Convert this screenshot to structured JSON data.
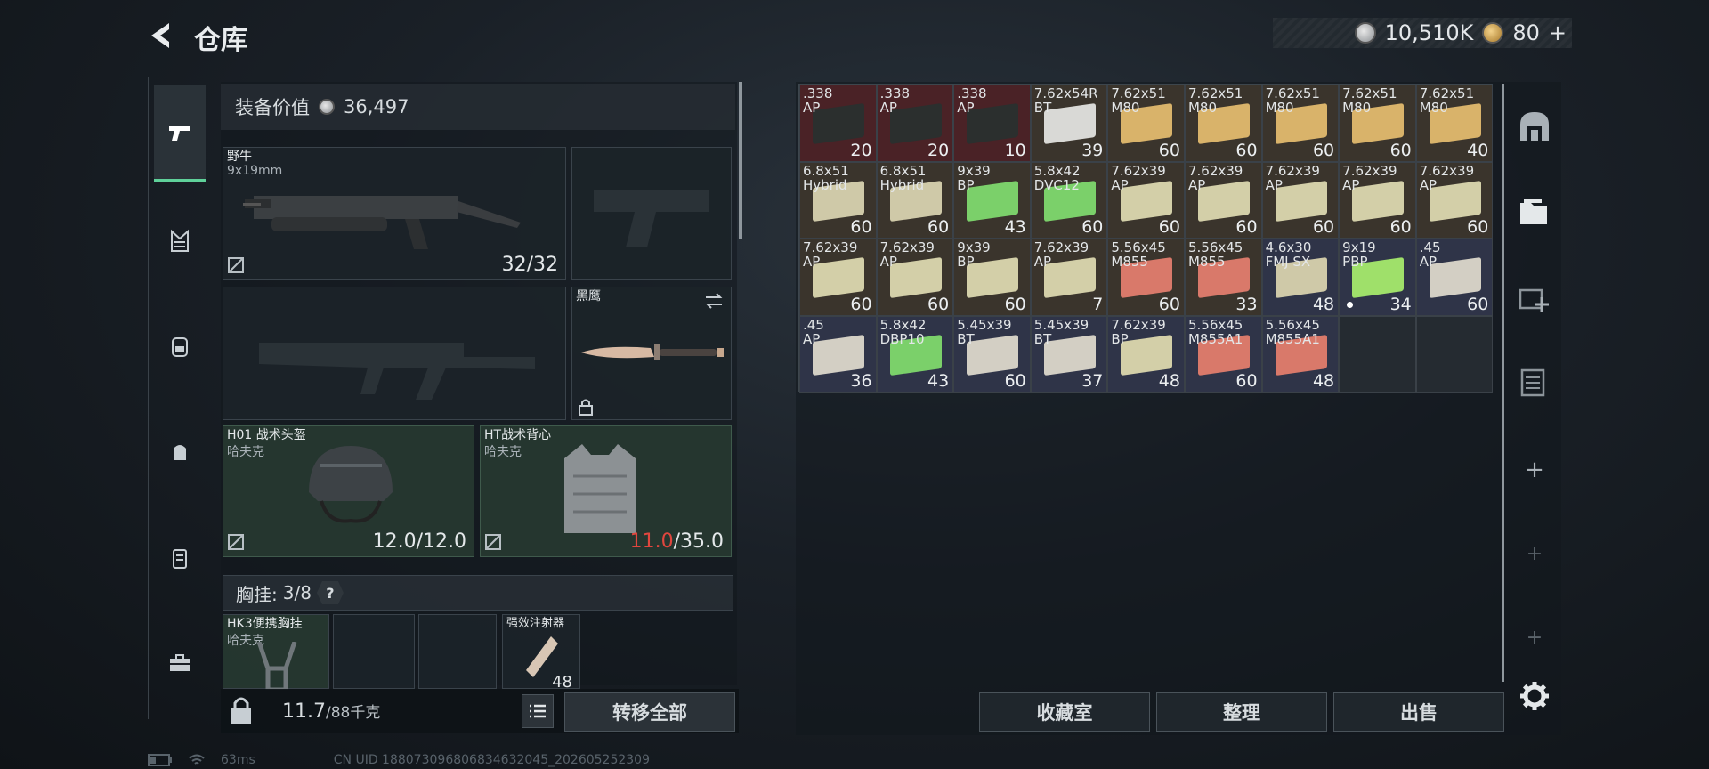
{
  "header": {
    "title": "仓库",
    "coins_value": "10,510K",
    "gold_value": "80",
    "gold_plus": "+"
  },
  "equipment_value": {
    "label": "装备价值",
    "value": "36,497"
  },
  "slots": {
    "primary": {
      "name": "野牛",
      "sub": "9x19mm",
      "count": "32/32"
    },
    "knife": {
      "name": "黑鹰"
    },
    "helmet": {
      "name": "H01 战术头盔",
      "sub": "哈夫克",
      "count": "12.0/12.0"
    },
    "vest": {
      "name": "HT战术背心",
      "sub": "哈夫克",
      "count_current": "11.0",
      "count_max": "/35.0"
    }
  },
  "rig": {
    "label": "胸挂:",
    "value": "3/8",
    "help": "?",
    "items": [
      {
        "name": "HK3便携胸挂",
        "sub": "哈夫克"
      },
      {
        "name": "强效注射器",
        "count": "48"
      }
    ]
  },
  "weight": {
    "value": "11.7",
    "max": "/88千克"
  },
  "buttons": {
    "transfer_all": "转移全部",
    "collection": "收藏室",
    "sort": "整理",
    "sell": "出售"
  },
  "inventory": [
    {
      "name": ".338\nAP",
      "count": "20",
      "bg": "red",
      "box": "#2b2f2e"
    },
    {
      "name": ".338\nAP",
      "count": "20",
      "bg": "red",
      "box": "#2b2f2e"
    },
    {
      "name": ".338\nAP",
      "count": "10",
      "bg": "red",
      "box": "#2b2f2e"
    },
    {
      "name": "7.62x54R\nBT",
      "count": "39",
      "bg": "brown",
      "box": "#d9d9d6"
    },
    {
      "name": "7.62x51\nM80",
      "count": "60",
      "bg": "brown",
      "box": "#d9b36a"
    },
    {
      "name": "7.62x51\nM80",
      "count": "60",
      "bg": "brown",
      "box": "#d9b36a"
    },
    {
      "name": "7.62x51\nM80",
      "count": "60",
      "bg": "brown",
      "box": "#d9b36a"
    },
    {
      "name": "7.62x51\nM80",
      "count": "60",
      "bg": "brown",
      "box": "#d9b36a"
    },
    {
      "name": "7.62x51\nM80",
      "count": "40",
      "bg": "brown",
      "box": "#d9b36a"
    },
    {
      "name": "6.8x51\nHybrid",
      "count": "60",
      "bg": "brown",
      "box": "#cfc9a8"
    },
    {
      "name": "6.8x51\nHybrid",
      "count": "60",
      "bg": "brown",
      "box": "#cfc9a8"
    },
    {
      "name": "9x39\nBP",
      "count": "43",
      "bg": "brown",
      "box": "#7bd06a"
    },
    {
      "name": "5.8x42\nDVC12",
      "count": "60",
      "bg": "brown",
      "box": "#7bd06a"
    },
    {
      "name": "7.62x39\nAP",
      "count": "60",
      "bg": "brown",
      "box": "#d3cfa8"
    },
    {
      "name": "7.62x39\nAP",
      "count": "60",
      "bg": "brown",
      "box": "#d3cfa8"
    },
    {
      "name": "7.62x39\nAP",
      "count": "60",
      "bg": "brown",
      "box": "#d3cfa8"
    },
    {
      "name": "7.62x39\nAP",
      "count": "60",
      "bg": "brown",
      "box": "#d3cfa8"
    },
    {
      "name": "7.62x39\nAP",
      "count": "60",
      "bg": "brown",
      "box": "#d3cfa8"
    },
    {
      "name": "7.62x39\nAP",
      "count": "60",
      "bg": "brown",
      "box": "#d3cfa8"
    },
    {
      "name": "7.62x39\nAP",
      "count": "60",
      "bg": "brown",
      "box": "#d3cfa8"
    },
    {
      "name": "9x39\nBP",
      "count": "60",
      "bg": "brown",
      "box": "#d3cfa8"
    },
    {
      "name": "7.62x39\nAP",
      "count": "7",
      "bg": "brown",
      "box": "#d3cfa8"
    },
    {
      "name": "5.56x45\nM855",
      "count": "60",
      "bg": "brown",
      "box": "#d9796a"
    },
    {
      "name": "5.56x45\nM855",
      "count": "33",
      "bg": "brown",
      "box": "#d9796a"
    },
    {
      "name": "4.6x30\nFMJ SX",
      "count": "48",
      "bg": "blue",
      "box": "#cfc9a8"
    },
    {
      "name": "9x19\nPBP",
      "count": "34",
      "bg": "blue",
      "box": "#9fe06a",
      "dot": true
    },
    {
      "name": ".45\nAP",
      "count": "60",
      "bg": "blue",
      "box": "#d3cfc4"
    },
    {
      "name": ".45\nAP",
      "count": "36",
      "bg": "blue",
      "box": "#d3cfc4"
    },
    {
      "name": "5.8x42\nDBP10",
      "count": "43",
      "bg": "blue",
      "box": "#7bd06a"
    },
    {
      "name": "5.45x39\nBT",
      "count": "60",
      "bg": "blue",
      "box": "#d3cfc4"
    },
    {
      "name": "5.45x39\nBT",
      "count": "37",
      "bg": "blue",
      "box": "#d3cfc4"
    },
    {
      "name": "7.62x39\nBP",
      "count": "48",
      "bg": "blue",
      "box": "#d3cfa8"
    },
    {
      "name": "5.56x45\nM855A1",
      "count": "60",
      "bg": "blue",
      "box": "#d9796a"
    },
    {
      "name": "5.56x45\nM855A1",
      "count": "48",
      "bg": "blue",
      "box": "#d9796a"
    },
    {
      "empty": true
    },
    {
      "empty": true
    }
  ],
  "status": {
    "ping": "63ms",
    "uid": "CN UID 1880730968068346320​45_202605252309"
  }
}
